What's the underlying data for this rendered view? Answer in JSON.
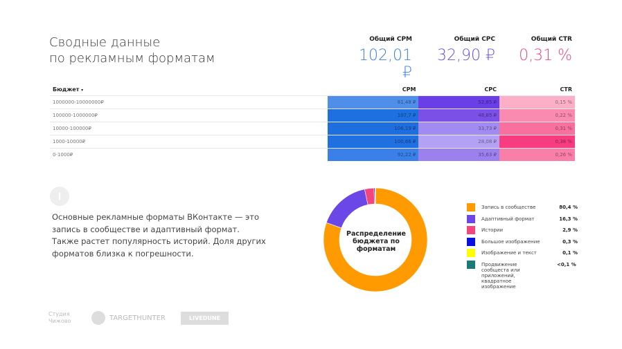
{
  "title": {
    "line1": "Сводные данные",
    "line2": "по рекламным форматам"
  },
  "kpis": [
    {
      "label": "Общий CPM",
      "value": "102,01 ₽",
      "color": "#3b7ee6"
    },
    {
      "label": "Общий CPC",
      "value": "32,90 ₽",
      "color": "#6a50e0"
    },
    {
      "label": "Общий CTR",
      "value": "0,31 %",
      "color": "#f0457f"
    }
  ],
  "table": {
    "headers": {
      "budget": "Бюджет",
      "sort": "▾",
      "cpm": "CPM",
      "cpc": "CPC",
      "ctr": "CTR"
    },
    "rows": [
      {
        "budget": "1000000-10000000₽",
        "cpm": "81,48 ₽",
        "cpc": "52,85 ₽",
        "ctr": "0,15 %",
        "c1": "#4f8fea",
        "c2": "#6a3fe8",
        "c3": "#fbb0c8"
      },
      {
        "budget": "100000-1000000₽",
        "cpm": "107,7 ₽",
        "cpc": "48,85 ₽",
        "ctr": "0,22 %",
        "c1": "#1e6fe0",
        "c2": "#7a50e6",
        "c3": "#f98ab0"
      },
      {
        "budget": "10000-100000₽",
        "cpm": "106,19 ₽",
        "cpc": "33,73 ₽",
        "ctr": "0,31 %",
        "c1": "#1f6ee0",
        "c2": "#a28bf0",
        "c3": "#f8709e"
      },
      {
        "budget": "1000-10000₽",
        "cpm": "100,66 ₽",
        "cpc": "28,08 ₽",
        "ctr": "0,38 %",
        "c1": "#2170e2",
        "c2": "#b3a2f4",
        "c3": "#f73d80"
      },
      {
        "budget": "0-1000₽",
        "cpm": "92,22 ₽",
        "cpc": "35,63 ₽",
        "ctr": "0,26 %",
        "c1": "#3a80e8",
        "c2": "#9c80ee",
        "c3": "#f97fa8"
      }
    ]
  },
  "info_text": "Основные рекламные форматы ВКонтакте — это запись в сообществе и адаптивный формат. Также растет популярность историй. Доля других форматов близка к погрешности.",
  "donut": {
    "label": "Распределение бюджета по форматам"
  },
  "chart_data": {
    "type": "pie",
    "title": "Распределение бюджета по форматам",
    "slices": [
      {
        "name": "Запись в сообществе",
        "value": 80.4,
        "label": "80,4 %",
        "color": "#ff9a00"
      },
      {
        "name": "Адаптивный формат",
        "value": 16.3,
        "label": "16,3 %",
        "color": "#6a47e6"
      },
      {
        "name": "Истории",
        "value": 2.9,
        "label": "2,9 %",
        "color": "#f5457f"
      },
      {
        "name": "Большое изображение",
        "value": 0.3,
        "label": "0,3 %",
        "color": "#0a10e0"
      },
      {
        "name": "Изображение и текст",
        "value": 0.1,
        "label": "0,1 %",
        "color": "#ffff00"
      },
      {
        "name": "Продвижение сообщеста или приложений, квадратное изображение",
        "value": 0.05,
        "label": "<0,1 %",
        "color": "#1a7a78"
      }
    ]
  },
  "logos": {
    "studio": "Студия Чижово",
    "targethunter": "TARGETHUNTER",
    "livedune": "LIVEDUNE"
  }
}
